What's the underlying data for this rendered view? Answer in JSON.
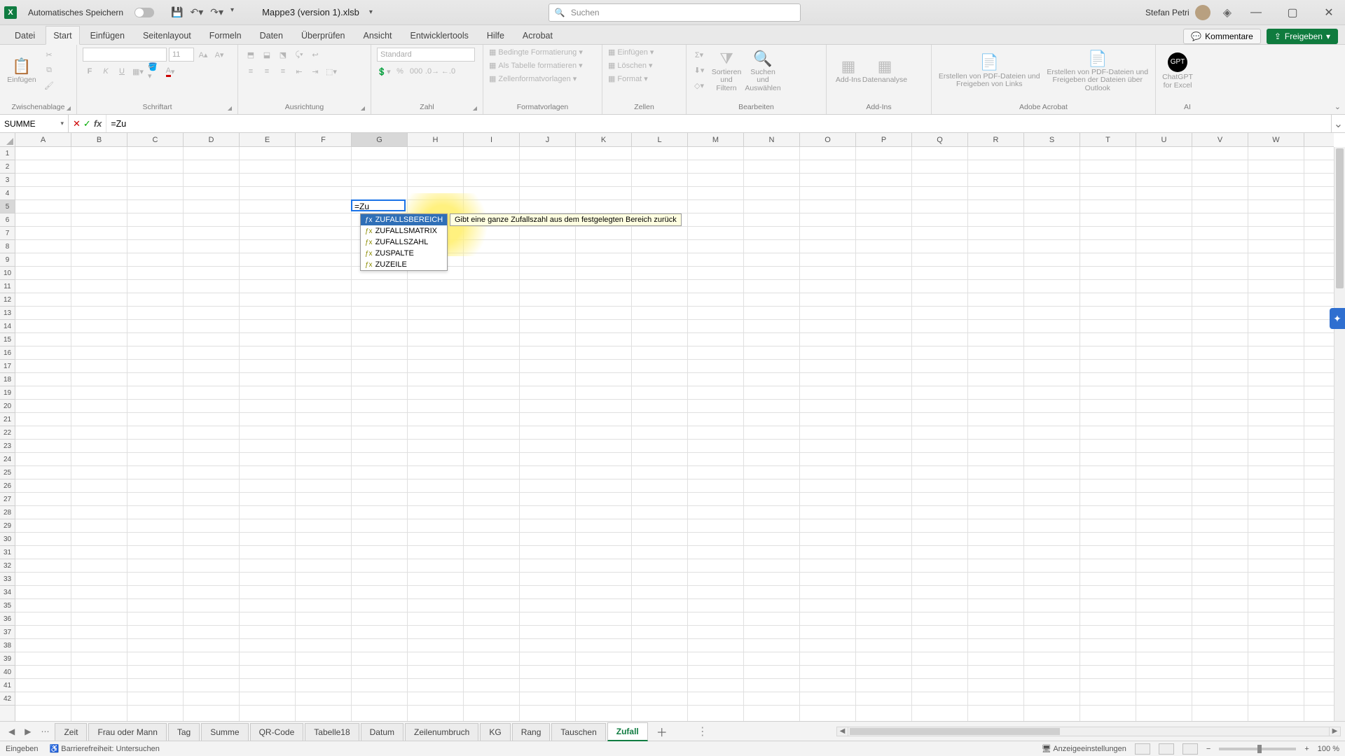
{
  "title": {
    "autosave_label": "Automatisches Speichern",
    "filename": "Mappe3 (version 1).xlsb",
    "search_placeholder": "Suchen",
    "username": "Stefan Petri"
  },
  "menu_tabs": [
    "Datei",
    "Start",
    "Einfügen",
    "Seitenlayout",
    "Formeln",
    "Daten",
    "Überprüfen",
    "Ansicht",
    "Entwicklertools",
    "Hilfe",
    "Acrobat"
  ],
  "menu_active_index": 1,
  "menu_right": {
    "comments": "Kommentare",
    "share": "Freigeben"
  },
  "ribbon": {
    "clipboard": {
      "paste": "Einfügen",
      "label": "Zwischenablage"
    },
    "font": {
      "name_placeholder": "",
      "size_placeholder": "11",
      "label": "Schriftart"
    },
    "align": {
      "label": "Ausrichtung"
    },
    "number": {
      "format": "Standard",
      "label": "Zahl"
    },
    "styles": {
      "cond": "Bedingte Formatierung",
      "table": "Als Tabelle formatieren",
      "cell": "Zellenformatvorlagen",
      "label": "Formatvorlagen"
    },
    "cells": {
      "insert": "Einfügen",
      "delete": "Löschen",
      "format": "Format",
      "label": "Zellen"
    },
    "editing": {
      "sort": "Sortieren und Filtern",
      "find": "Suchen und Auswählen",
      "label": "Bearbeiten"
    },
    "addins": {
      "addins": "Add-Ins",
      "analysis": "Datenanalyse",
      "label": "Add-Ins"
    },
    "acrobat": {
      "links": "Erstellen von PDF-Dateien und Freigeben von Links",
      "outlook": "Erstellen von PDF-Dateien und Freigeben der Dateien über Outlook",
      "label": "Adobe Acrobat"
    },
    "ai": {
      "gpt": "ChatGPT for Excel",
      "label": "AI"
    }
  },
  "formula_bar": {
    "name_box": "SUMME",
    "formula": "=Zu"
  },
  "columns": [
    "A",
    "B",
    "C",
    "D",
    "E",
    "F",
    "G",
    "H",
    "I",
    "J",
    "K",
    "L",
    "M",
    "N",
    "O",
    "P",
    "Q",
    "R",
    "S",
    "T",
    "U",
    "V",
    "W"
  ],
  "active_cell": {
    "col_index": 6,
    "row_index": 4,
    "value": "=Zu"
  },
  "autocomplete": {
    "items": [
      "ZUFALLSBEREICH",
      "ZUFALLSMATRIX",
      "ZUFALLSZAHL",
      "ZUSPALTE",
      "ZUZEILE"
    ],
    "selected_index": 0,
    "tooltip": "Gibt eine ganze Zufallszahl aus dem festgelegten Bereich zurück"
  },
  "sheet_tabs": [
    "Zeit",
    "Frau oder Mann",
    "Tag",
    "Summe",
    "QR-Code",
    "Tabelle18",
    "Datum",
    "Zeilenumbruch",
    "KG",
    "Rang",
    "Tauschen",
    "Zufall"
  ],
  "sheet_active_index": 11,
  "status": {
    "mode": "Eingeben",
    "accessibility": "Barrierefreiheit: Untersuchen",
    "display_settings": "Anzeigeeinstellungen",
    "zoom": "100 %"
  }
}
